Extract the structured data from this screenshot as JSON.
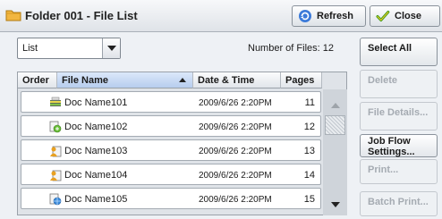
{
  "title": "Folder 001 - File List",
  "toolbar": {
    "refresh_label": "Refresh",
    "close_label": "Close"
  },
  "list_type": {
    "selected": "List"
  },
  "file_count_text": "Number of Files:  12",
  "columns": {
    "order": "Order",
    "file_name": "File Name",
    "date_time": "Date & Time",
    "pages": "Pages"
  },
  "rows": [
    {
      "name": "Doc Name101",
      "date": "2009/6/26 2:20PM",
      "pages": "11",
      "icon": "scanner-doc-icon"
    },
    {
      "name": "Doc Name102",
      "date": "2009/6/26 2:20PM",
      "pages": "12",
      "icon": "fax-doc-icon"
    },
    {
      "name": "Doc Name103",
      "date": "2009/6/26 2:20PM",
      "pages": "13",
      "icon": "user-doc-icon"
    },
    {
      "name": "Doc Name104",
      "date": "2009/6/26 2:20PM",
      "pages": "14",
      "icon": "user-doc-icon"
    },
    {
      "name": "Doc Name105",
      "date": "2009/6/26 2:20PM",
      "pages": "15",
      "icon": "internet-fax-doc-icon"
    }
  ],
  "side_buttons": {
    "select_all": "Select All",
    "delete": "Delete",
    "file_details": "File Details...",
    "job_flow_line1": "Job Flow",
    "job_flow_line2": "Settings...",
    "print": "Print...",
    "batch_print": "Batch Print..."
  },
  "colors": {
    "accent": "#b7cdee",
    "disabled_text": "#a5abb2"
  }
}
